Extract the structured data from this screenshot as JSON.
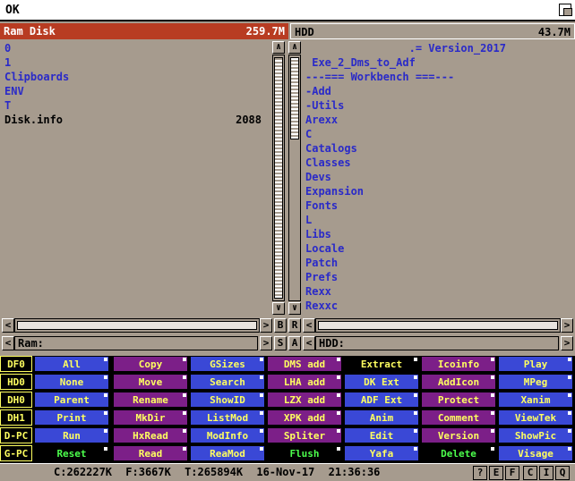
{
  "screen": {
    "title": "OK"
  },
  "left": {
    "name": "Ram Disk",
    "size": "259.7M",
    "path": "Ram:",
    "items": [
      {
        "name": "0",
        "type": "dir"
      },
      {
        "name": "1",
        "type": "dir"
      },
      {
        "name": "Clipboards",
        "type": "dir"
      },
      {
        "name": "ENV",
        "type": "dir"
      },
      {
        "name": "T",
        "type": "dir"
      },
      {
        "name": "Disk.info",
        "type": "file",
        "size": "2088"
      }
    ]
  },
  "right": {
    "name": "HDD",
    "size": "43.7M",
    "path": "HDD:",
    "items": [
      "                .= Version_2017",
      " Exe_2_Dms_to_Adf",
      "---=== Workbench ===---",
      "-Add",
      "-Utils",
      "Arexx",
      "C",
      "Catalogs",
      "Classes",
      "Devs",
      "Expansion",
      "Fonts",
      "L",
      "Libs",
      "Locale",
      "Patch",
      "Prefs",
      "Rexx",
      "Rexxc"
    ]
  },
  "side_buttons": {
    "b": "B",
    "r": "R",
    "s": "S",
    "a": "A"
  },
  "drives": [
    "DF0",
    "HD0",
    "DH0",
    "DH1",
    "D-PC",
    "G-PC"
  ],
  "grid": [
    [
      "All",
      "Copy",
      "GSizes",
      "DMS add",
      "Extract",
      "Icoinfo",
      "Play"
    ],
    [
      "None",
      "Move",
      "Search",
      "LHA add",
      "DK Ext",
      "AddIcon",
      "MPeg"
    ],
    [
      "Parent",
      "Rename",
      "ShowID",
      "LZX add",
      "ADF Ext",
      "Protect",
      "Xanim"
    ],
    [
      "Print",
      "MkDir",
      "ListMod",
      "XPK add",
      "Anim",
      "Comment",
      "ViewTek"
    ],
    [
      "Run",
      "HxRead",
      "ModInfo",
      "Spliter",
      "Edit",
      "Version",
      "ShowPic"
    ],
    [
      "Reset",
      "Read",
      "ReaMod",
      "Flush",
      "Yafa",
      "Delete",
      "Visage"
    ]
  ],
  "grid_colors": [
    [
      "blue",
      "purple",
      "blue",
      "purple",
      "black",
      "purple",
      "blue"
    ],
    [
      "blue",
      "purple",
      "blue",
      "purple",
      "blue",
      "purple",
      "blue"
    ],
    [
      "blue",
      "purple",
      "blue",
      "purple",
      "blue",
      "purple",
      "blue"
    ],
    [
      "blue",
      "purple",
      "blue",
      "purple",
      "blue",
      "purple",
      "blue"
    ],
    [
      "blue",
      "purple",
      "blue",
      "purple",
      "blue",
      "purple",
      "blue"
    ],
    [
      "green-black",
      "purple",
      "blue",
      "green-black",
      "blue",
      "green-black",
      "blue"
    ]
  ],
  "status": {
    "chip": "C:262227K",
    "fast": "F:3667K",
    "total": "T:265894K",
    "date": "16-Nov-17",
    "time": "21:36:36"
  },
  "status_buttons": [
    "?",
    "E",
    "F",
    "C",
    "I",
    "Q"
  ]
}
